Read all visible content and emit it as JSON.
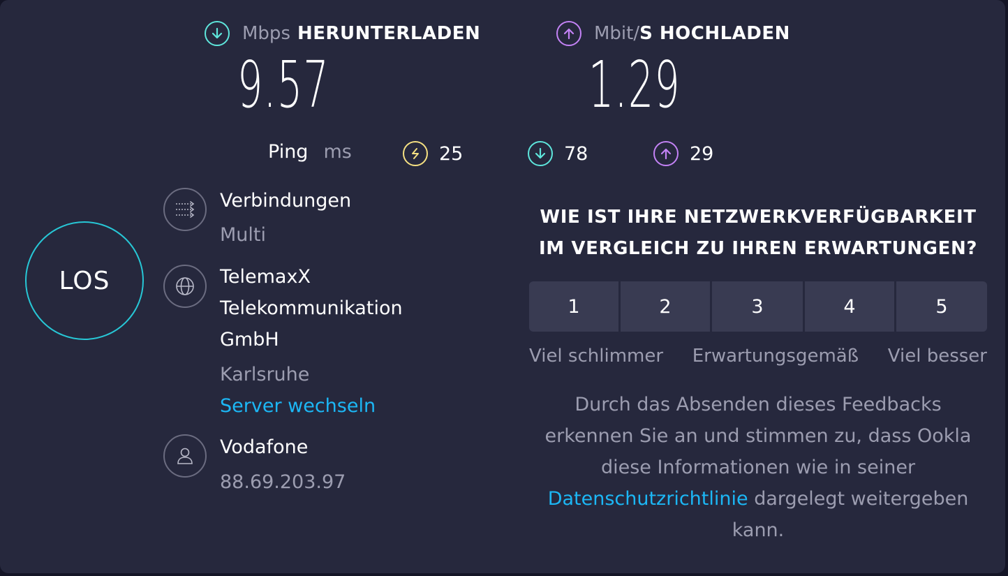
{
  "download": {
    "unit": "Mbps",
    "title": "HERUNTERLADEN",
    "value": "9.57",
    "icon": "download-arrow-icon",
    "color": "#5ee6dc"
  },
  "upload": {
    "unit": "Mbit/",
    "title": "S HOCHLADEN",
    "value": "1.29",
    "icon": "upload-arrow-icon",
    "color": "#c382f5"
  },
  "ping": {
    "label": "Ping",
    "unit": "ms",
    "idle": "25",
    "down": "78",
    "up": "29",
    "idle_color": "#f5e082"
  },
  "start_button": {
    "label": "LOS",
    "color": "#27c7d6"
  },
  "connections": {
    "label": "Verbindungen",
    "value": "Multi"
  },
  "server": {
    "name_lines": [
      "TelemaxX",
      "Telekommunikation",
      "GmbH"
    ],
    "location": "Karlsruhe",
    "change_link": "Server wechseln"
  },
  "provider": {
    "name": "Vodafone",
    "ip": "88.69.203.97"
  },
  "survey": {
    "question_lines": [
      "WIE IST IHRE NETZWERKVERFÜGBARKEIT",
      "IM VERGLEICH ZU IHREN ERWARTUNGEN?"
    ],
    "ratings": [
      "1",
      "2",
      "3",
      "4",
      "5"
    ],
    "scale_low": "Viel schlimmer",
    "scale_mid": "Erwartungsgemäß",
    "scale_high": "Viel besser"
  },
  "disclaimer": {
    "line1": "Durch das Absenden dieses Feedbacks",
    "line2": "erkennen Sie an und stimmen zu, dass Ookla",
    "line3": "diese Informationen wie in seiner",
    "link": "Datenschutzrichtlinie",
    "line4_rest": " dargelegt weitergeben",
    "line5": "kann."
  },
  "colors": {
    "background": "#26283d",
    "link": "#1cb7f5",
    "muted": "#9c9db0"
  }
}
